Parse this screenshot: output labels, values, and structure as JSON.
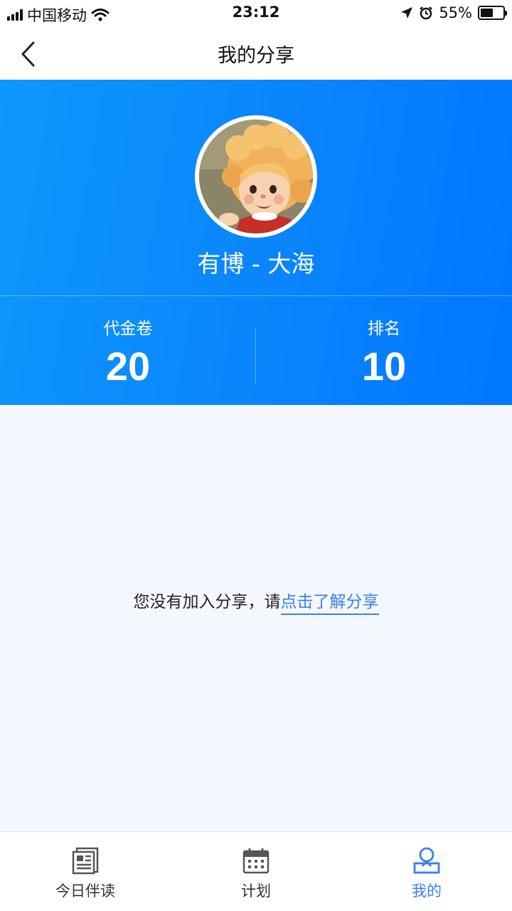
{
  "status_bar": {
    "carrier": "中国移动",
    "time": "23:12",
    "battery_percent": "55%",
    "battery_level": 0.55
  },
  "nav": {
    "title": "我的分享",
    "back_icon": "chevron-left-icon"
  },
  "profile": {
    "name": "有博 - 大海",
    "avatar_icon": "cartoon-girl-avatar",
    "stats": [
      {
        "label": "代金卷",
        "value": "20"
      },
      {
        "label": "排名",
        "value": "10"
      }
    ]
  },
  "content": {
    "empty_text": "您没有加入分享，请",
    "link_text": "点击了解分享"
  },
  "tab_bar": {
    "tabs": [
      {
        "label": "今日伴读",
        "icon": "newspaper-icon",
        "active": false
      },
      {
        "label": "计划",
        "icon": "calendar-icon",
        "active": false
      },
      {
        "label": "我的",
        "icon": "person-icon",
        "active": true
      }
    ]
  },
  "colors": {
    "header_gradient_start": "#0d98fb",
    "header_gradient_end": "#0277ff",
    "accent": "#3a7ef0",
    "page_background": "#f4f8fe"
  }
}
